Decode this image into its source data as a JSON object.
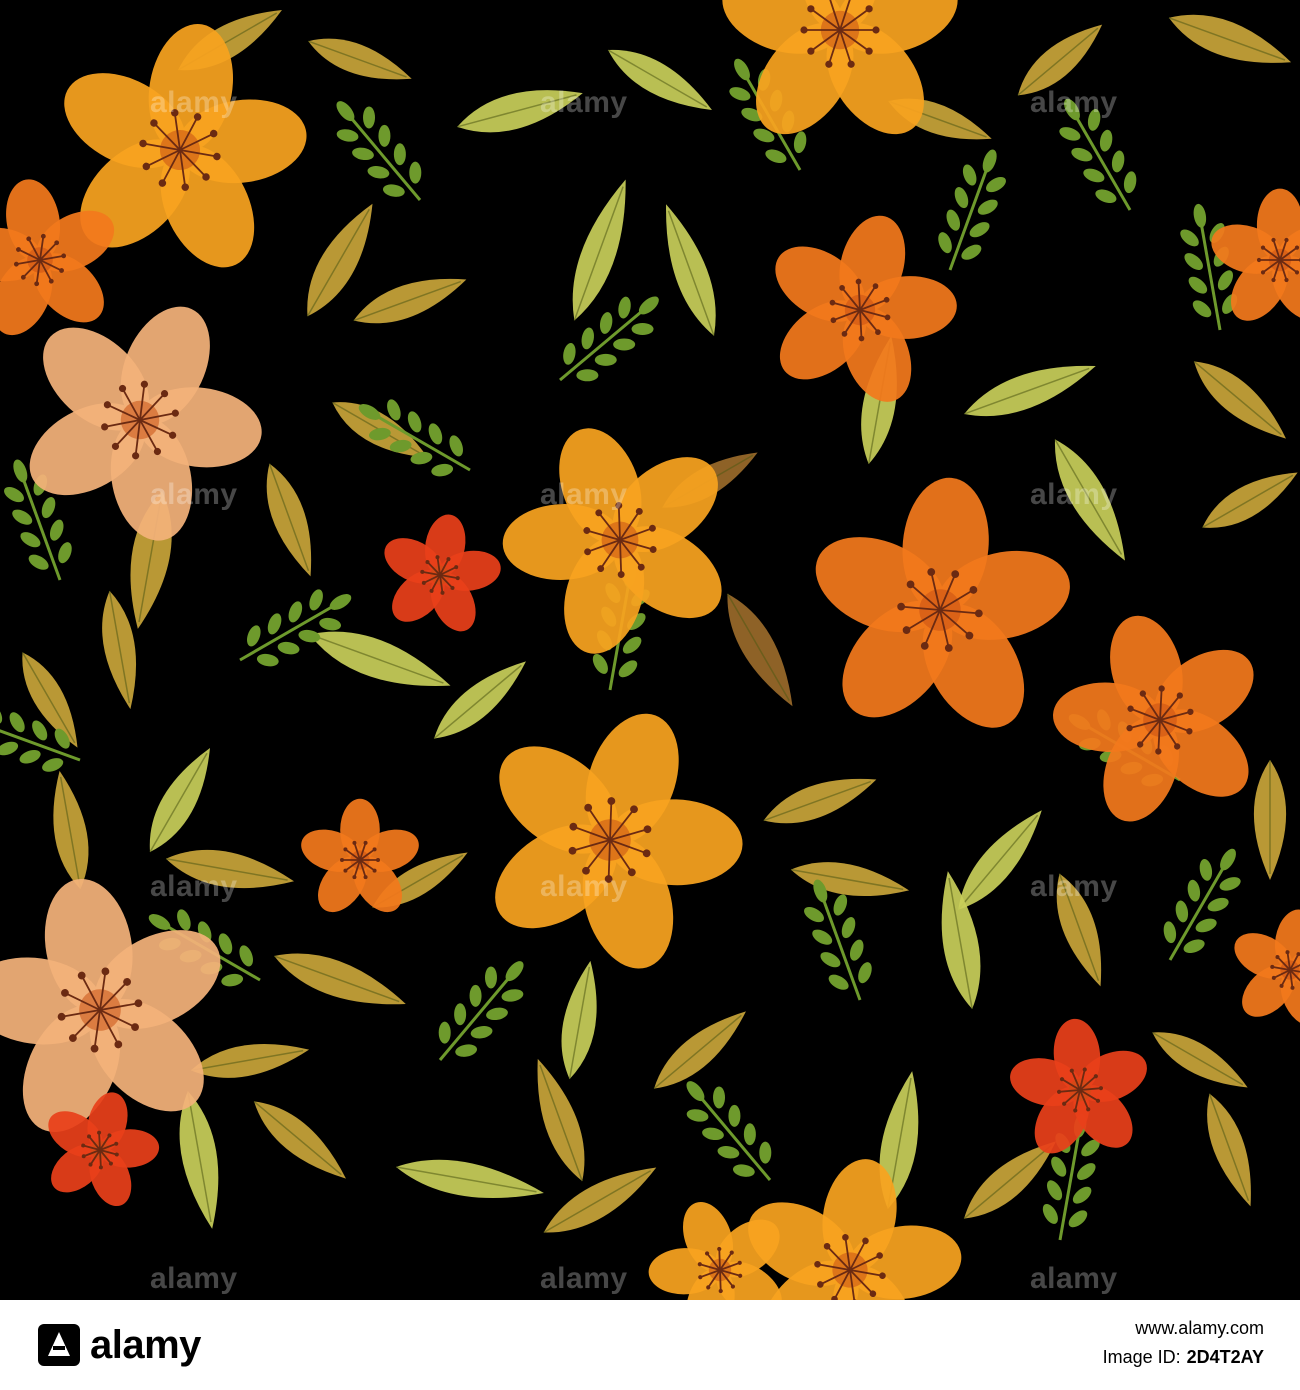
{
  "palette": {
    "background": "#000000",
    "petal_yellow_orange": "#f7a21f",
    "petal_orange": "#f2791c",
    "petal_red": "#e8401a",
    "petal_peach": "#f3b27a",
    "leaf_light": "#c9cf5a",
    "leaf_ochre": "#c9a53a",
    "leaf_green": "#6e9a2c",
    "leaf_brown": "#9a6a2a",
    "stamen": "#6b2a12"
  },
  "watermark": {
    "text": "alamy"
  },
  "footer": {
    "logo_text": "alamy",
    "url": "www.alamy.com",
    "image_id_label": "Image ID:",
    "image_id": "2D4T2AY"
  }
}
